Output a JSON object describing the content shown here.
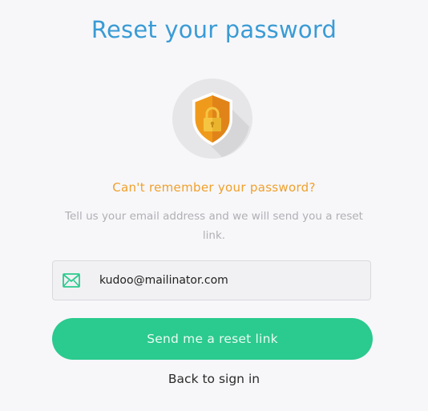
{
  "page": {
    "title": "Reset your password",
    "subtitle": "Can't remember your password?",
    "description": "Tell us your email address and we will send you a reset link."
  },
  "form": {
    "email_value": "kudoo@mailinator.com",
    "email_icon": "mail-icon",
    "submit_label": "Send me a reset link"
  },
  "footer": {
    "back_link_label": "Back to sign in"
  },
  "emblem": {
    "icon": "shield-lock-icon"
  },
  "colors": {
    "title": "#3a9bd5",
    "subtitle": "#f0a02a",
    "button": "#2bca8e",
    "icon_green": "#2bca8e",
    "shield_orange": "#f09a1c",
    "lock_yellow": "#f5c542"
  }
}
